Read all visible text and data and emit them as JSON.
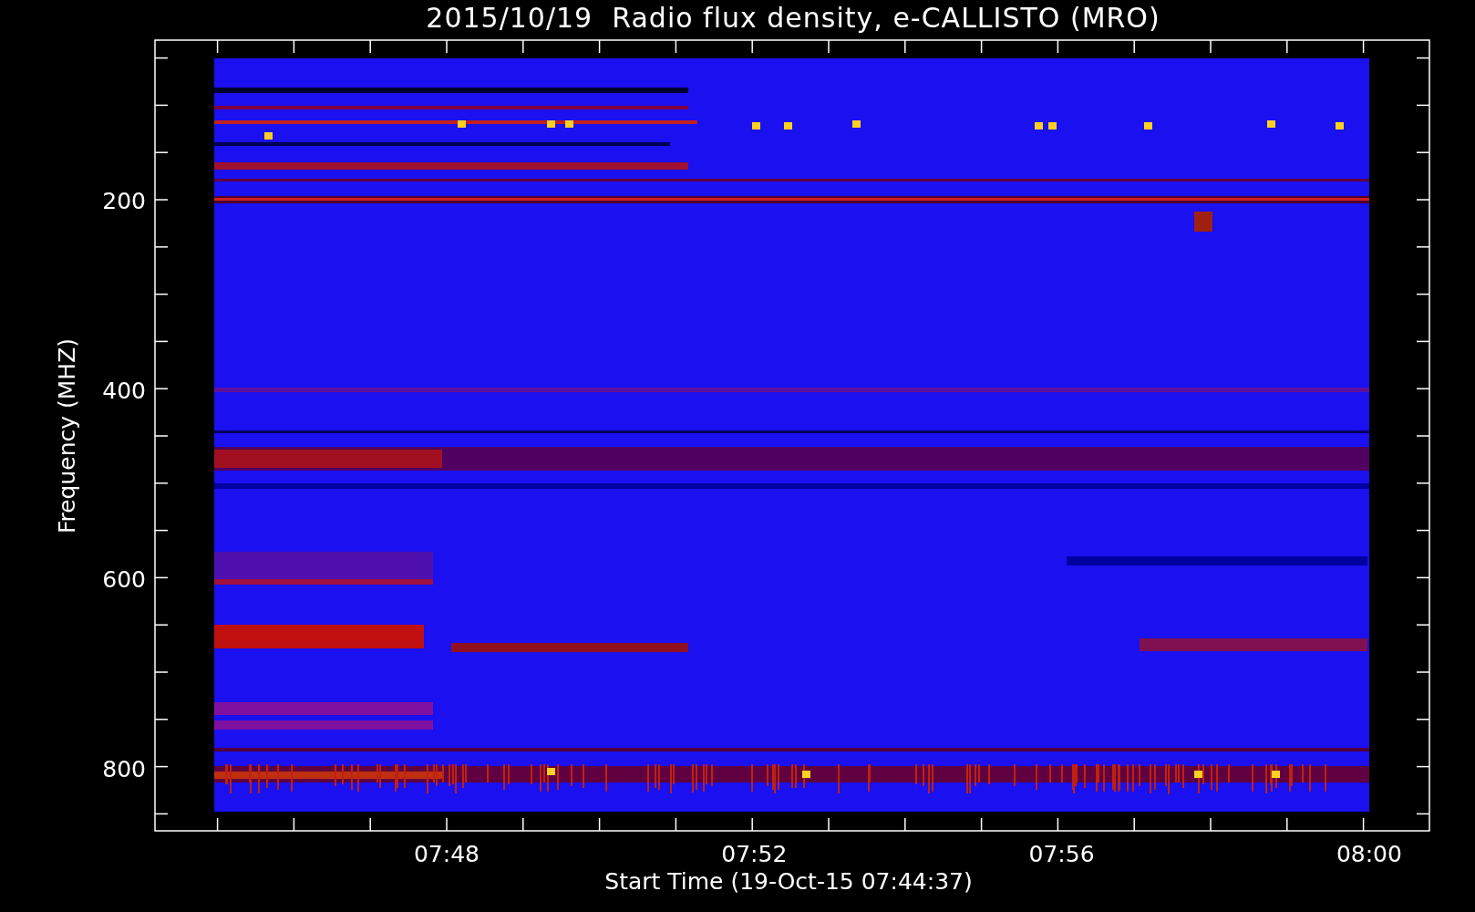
{
  "title": "2015/10/19  Radio flux density, e-CALLISTO (MRO)",
  "y_axis": {
    "label": "Frequency (MHZ)",
    "ticks": [
      "200",
      "400",
      "600",
      "800"
    ]
  },
  "x_axis": {
    "label": "Start Time (19-Oct-15 07:44:37)",
    "ticks": [
      "07:48",
      "07:52",
      "07:56",
      "08:00"
    ]
  }
}
